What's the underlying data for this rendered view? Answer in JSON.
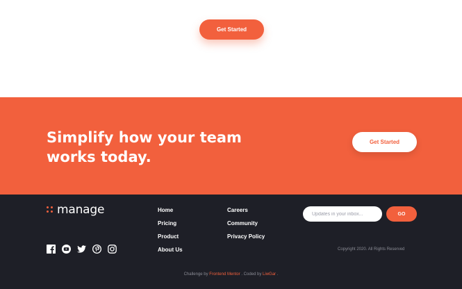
{
  "hero": {
    "cta_label": "Get Started"
  },
  "cta_band": {
    "title": "Simplify how your team works today.",
    "cta_label": "Get Started"
  },
  "footer": {
    "logo_text": "manage",
    "nav_col1": [
      "Home",
      "Pricing",
      "Product",
      "About Us"
    ],
    "nav_col2": [
      "Careers",
      "Community",
      "Privacy Policy"
    ],
    "newsletter": {
      "placeholder": "Updates in your inbox...",
      "button": "GO"
    },
    "socials": [
      "facebook-icon",
      "youtube-icon",
      "twitter-icon",
      "pinterest-icon",
      "instagram-icon"
    ],
    "copyright": "Copyright 2020. All Rights Reserved",
    "attribution": {
      "prefix": "Challenge by",
      "challenge_link": "Frontend Mentor",
      "middle": ". Coded by",
      "author_link": "LiwGar",
      "suffix": "."
    }
  },
  "colors": {
    "accent": "#f2603d",
    "footer_bg": "#1e1f27",
    "text_light": "#ffffff",
    "muted": "#8b8c95"
  }
}
